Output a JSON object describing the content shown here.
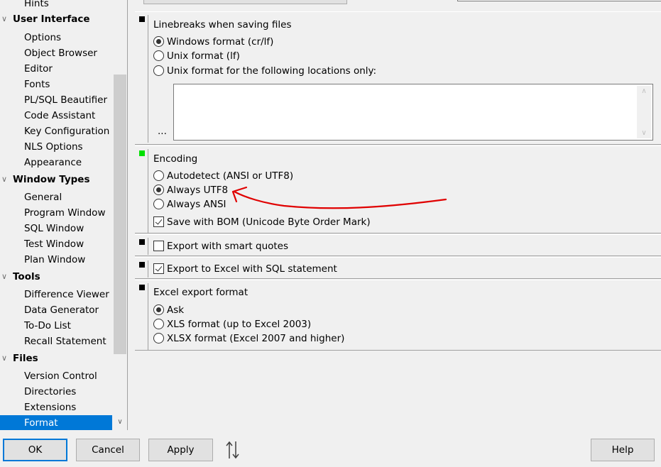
{
  "sidebar": {
    "partial_top_item": "Hints",
    "groups": [
      {
        "label": "User Interface",
        "items": [
          "Options",
          "Object Browser",
          "Editor",
          "Fonts",
          "PL/SQL Beautifier",
          "Code Assistant",
          "Key Configuration",
          "NLS Options",
          "Appearance"
        ]
      },
      {
        "label": "Window Types",
        "items": [
          "General",
          "Program Window",
          "SQL Window",
          "Test Window",
          "Plan Window"
        ]
      },
      {
        "label": "Tools",
        "items": [
          "Difference Viewer",
          "Data Generator",
          "To-Do List",
          "Recall Statement"
        ]
      },
      {
        "label": "Files",
        "items": [
          "Version Control",
          "Directories",
          "Extensions",
          "Format"
        ]
      }
    ],
    "selected": "Format",
    "selection_color": "#0078d7"
  },
  "linebreaks": {
    "title": "Linebreaks when saving files",
    "options": [
      "Windows format (cr/lf)",
      "Unix format (lf)",
      "Unix format for the following locations only:"
    ],
    "selected_index": 0,
    "locations_value": "",
    "ellipsis_label": "..."
  },
  "encoding": {
    "title": "Encoding",
    "options": [
      "Autodetect (ANSI or UTF8)",
      "Always UTF8",
      "Always ANSI"
    ],
    "selected_index": 1,
    "bom_label": "Save with BOM (Unicode Byte Order Mark)",
    "bom_checked": true,
    "marker_color": "#00e000"
  },
  "smart_quotes": {
    "label": "Export with smart quotes",
    "checked": false
  },
  "excel_sql": {
    "label": "Export to Excel with SQL statement",
    "checked": true
  },
  "excel_format": {
    "title": "Excel export format",
    "options": [
      "Ask",
      "XLS format (up to Excel 2003)",
      "XLSX format (Excel 2007 and higher)"
    ],
    "selected_index": 0
  },
  "annotation": {
    "type": "red-arrow",
    "points_to": "Always UTF8",
    "color": "#e00000"
  },
  "buttons": {
    "ok": "OK",
    "cancel": "Cancel",
    "apply": "Apply",
    "help": "Help",
    "sort_icon": "sort-up-down-icon"
  }
}
